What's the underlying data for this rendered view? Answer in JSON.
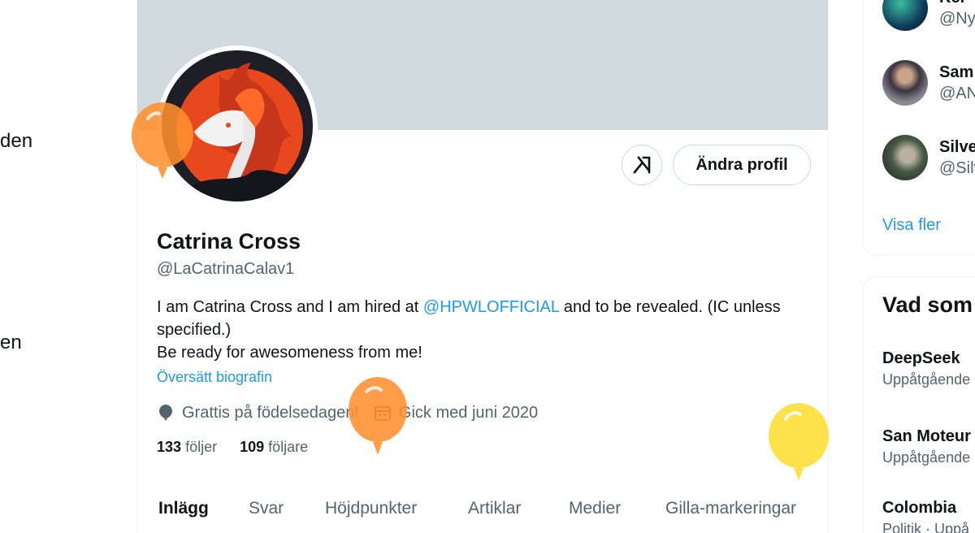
{
  "left_nav": {
    "fragment_1": "den",
    "fragment_2": "en"
  },
  "profile": {
    "name": "Catrina Cross",
    "handle": "@LaCatrinaCalav1",
    "bio_line1_prefix": "I am Catrina Cross and I am hired at ",
    "bio_mention": "@HPWLOFFICIAL",
    "bio_line1_suffix": " and to be revealed. (IC unless specified.)",
    "bio_line2": "Be ready for awesomeness from me!",
    "translate_link": "Översätt biografin",
    "birthday": "Grattis på födelsedagen!",
    "joined": "Gick med juni 2020",
    "following_count": "133",
    "following_label": "följer",
    "followers_count": "109",
    "followers_label": "följare",
    "edit_button": "Ändra profil",
    "grok_icon": "grok-icon"
  },
  "tabs": [
    "Inlägg",
    "Svar",
    "Höjdpunkter",
    "Artiklar",
    "Medier",
    "Gilla-markeringar"
  ],
  "who_to_follow": [
    {
      "name": "Kei",
      "handle": "@Ny"
    },
    {
      "name": "Sam",
      "handle": "@AN"
    },
    {
      "name": "Silve",
      "handle": "@Silv"
    }
  ],
  "show_more": "Visa fler",
  "trends": {
    "title": "Vad som",
    "items": [
      {
        "name": "DeepSeek",
        "meta": "Uppåtgående"
      },
      {
        "name": "San Moteur",
        "meta": "Uppåtgående"
      },
      {
        "name": "Colombia",
        "meta": "Politik · Uppå"
      }
    ]
  },
  "colors": {
    "accent": "#1d9bf0",
    "secondary_text": "#536471",
    "banner": "#cfd9de",
    "balloon_orange": "#ff8f2f",
    "balloon_yellow": "#ffde3b"
  }
}
